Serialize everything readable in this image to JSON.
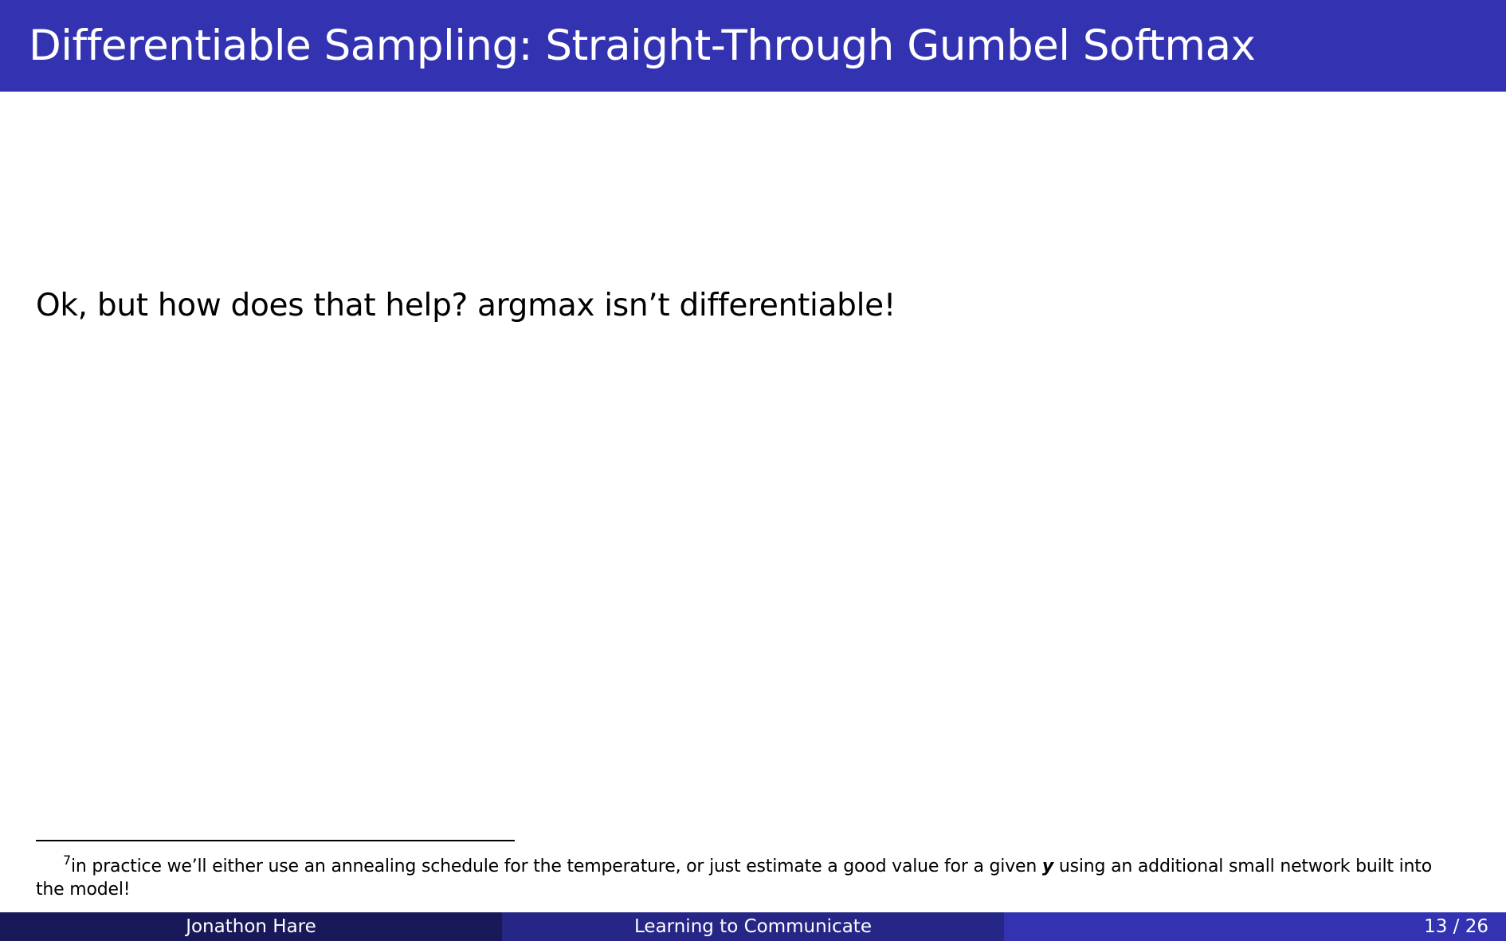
{
  "slide": {
    "title": "Differentiable Sampling: Straight-Through Gumbel Softmax",
    "body": "Ok, but how does that help? argmax isn’t differentiable!"
  },
  "footnote": {
    "marker": "7",
    "text_before": "in practice we’ll either use an annealing schedule for the temperature, or just estimate a good value for a given ",
    "symbol": "y",
    "text_after": " using an additional small network built into the model!"
  },
  "footer": {
    "author": "Jonathon Hare",
    "talk_title": "Learning to Communicate",
    "page": "13 / 26"
  },
  "colors": {
    "title_bar": "#3333b2",
    "footer_left": "#191959",
    "footer_middle": "#262686",
    "footer_right": "#3333b2"
  }
}
